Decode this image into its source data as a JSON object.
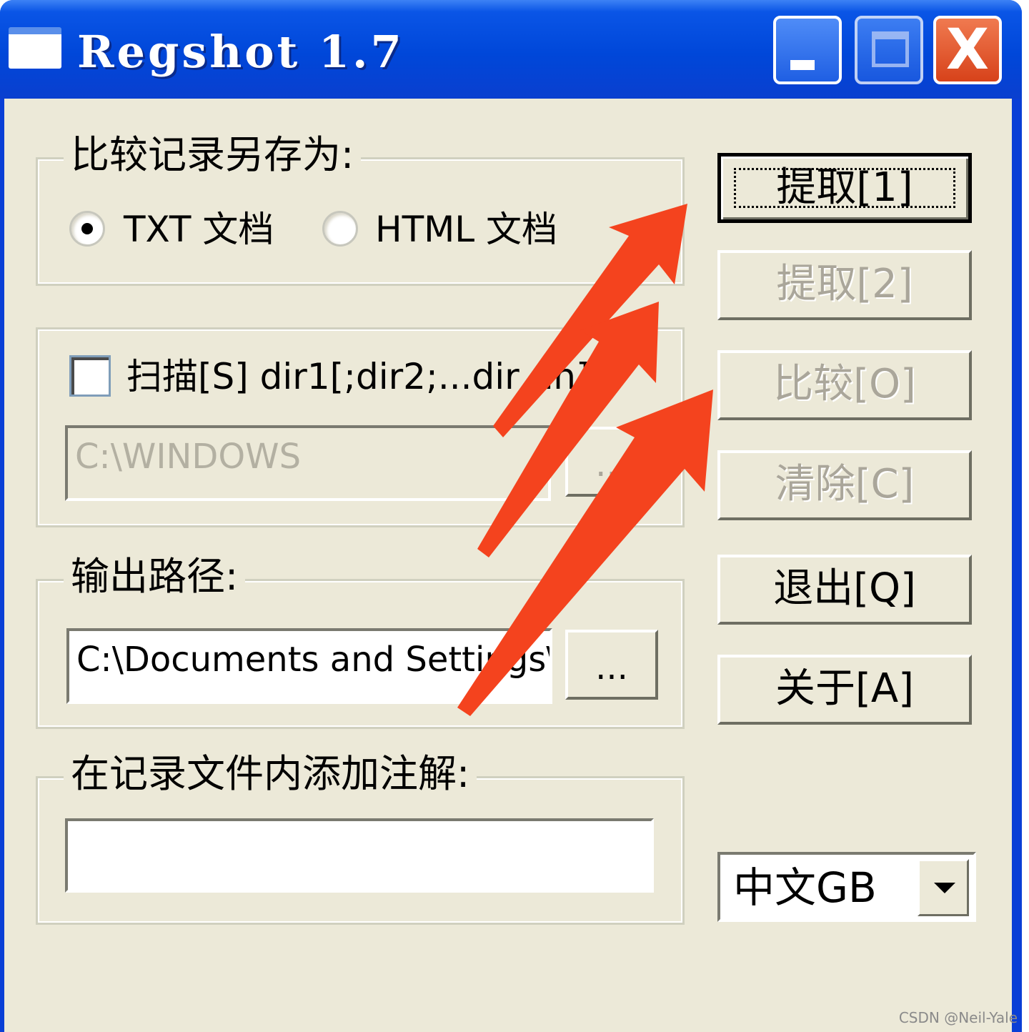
{
  "window": {
    "title": "Regshot 1.7",
    "minimize_label": "_",
    "maximize_label": "",
    "close_label": "X"
  },
  "save_as_group": {
    "label": "比较记录另存为:",
    "txt_option": "TXT 文档",
    "txt_selected": true,
    "html_option": "HTML 文档",
    "html_selected": false
  },
  "scan_group": {
    "checkbox_label": "扫描[S] dir1[;dir2;...dir nn]",
    "checked": false,
    "path_value": "C:\\WINDOWS",
    "browse_label": "..."
  },
  "output_group": {
    "label": "输出路径:",
    "path_value": "C:\\Documents and Settings\\",
    "browse_label": "..."
  },
  "comment_group": {
    "label": "在记录文件内添加注解:",
    "comment_value": ""
  },
  "buttons": {
    "shot1": "提取[1]",
    "shot2": "提取[2]",
    "compare": "比较[O]",
    "clear": "清除[C]",
    "quit": "退出[Q]",
    "about": "关于[A]"
  },
  "language": {
    "selected": "中文GB"
  },
  "annotation": {
    "arrow_color": "#f4431e"
  },
  "watermark": "CSDN @Neil-Yale"
}
